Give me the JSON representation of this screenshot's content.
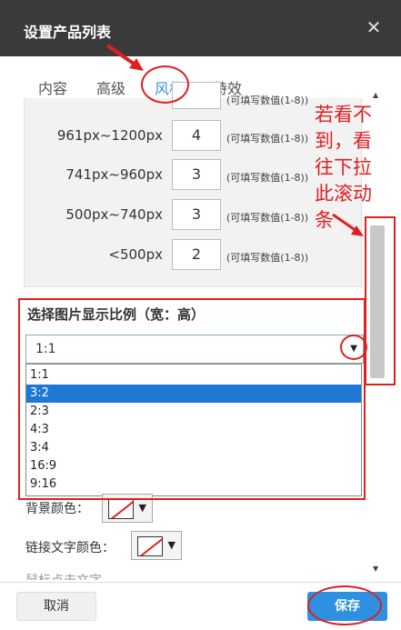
{
  "dialog": {
    "title": "设置产品列表",
    "close_icon": "close-icon"
  },
  "tabs": [
    {
      "label": "内容"
    },
    {
      "label": "高级"
    },
    {
      "label": "风格"
    },
    {
      "label": "特效"
    }
  ],
  "columns": {
    "rows": [
      {
        "label": "961px~1200px",
        "value": "4",
        "hint": "(可填写数值(1-8))"
      },
      {
        "label": "741px~960px",
        "value": "3",
        "hint": "(可填写数值(1-8))"
      },
      {
        "label": "500px~740px",
        "value": "3",
        "hint": "(可填写数值(1-8))"
      },
      {
        "label": "<500px",
        "value": "2",
        "hint": "(可填写数值(1-8))"
      }
    ],
    "top_partial_hint": "(可填写数值(1-8))"
  },
  "ratio": {
    "title": "选择图片显示比例（宽：高）",
    "selected": "1:1",
    "options": [
      "1:1",
      "3:2",
      "2:3",
      "4:3",
      "3:4",
      "16:9",
      "9:16"
    ],
    "highlighted": "3:2"
  },
  "colors": {
    "bg_label": "背景颜色：",
    "link_label": "链接文字颜色：",
    "next_partial": "鼠标点击文字"
  },
  "annotation": {
    "text": "若看不到，看往下拉此滚动条",
    "color": "#e02020"
  },
  "footer": {
    "cancel": "取消",
    "save": "保存"
  },
  "theme": {
    "accent": "#2e90e0",
    "titlebar": "#3a3a3a"
  }
}
